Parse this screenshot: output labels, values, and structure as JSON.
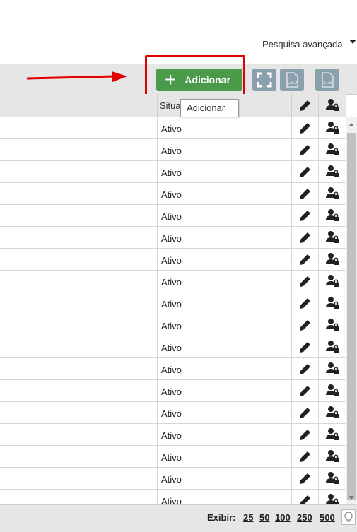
{
  "search": {
    "advanced_label": "Pesquisa avançada"
  },
  "toolbar": {
    "add_label": "Adicionar",
    "csv_label": "CSV",
    "xls_label": "XLS"
  },
  "tooltip": {
    "text": "Adicionar"
  },
  "table": {
    "header_status": "Situa",
    "rows": [
      {
        "status": "Ativo"
      },
      {
        "status": "Ativo"
      },
      {
        "status": "Ativo"
      },
      {
        "status": "Ativo"
      },
      {
        "status": "Ativo"
      },
      {
        "status": "Ativo"
      },
      {
        "status": "Ativo"
      },
      {
        "status": "Ativo"
      },
      {
        "status": "Ativo"
      },
      {
        "status": "Ativo"
      },
      {
        "status": "Ativo"
      },
      {
        "status": "Ativo"
      },
      {
        "status": "Ativo"
      },
      {
        "status": "Ativo"
      },
      {
        "status": "Ativo"
      },
      {
        "status": "Ativo"
      },
      {
        "status": "Ativo"
      },
      {
        "status": "Ativo"
      }
    ]
  },
  "footer": {
    "show_label": "Exibir:",
    "page_sizes": [
      "25",
      "50",
      "100",
      "250",
      "500"
    ]
  },
  "colors": {
    "add_button": "#4a9a4a",
    "icon_button": "#8aa0ad",
    "highlight": "#e00000",
    "toolbar_bg": "#e6e6e6"
  }
}
